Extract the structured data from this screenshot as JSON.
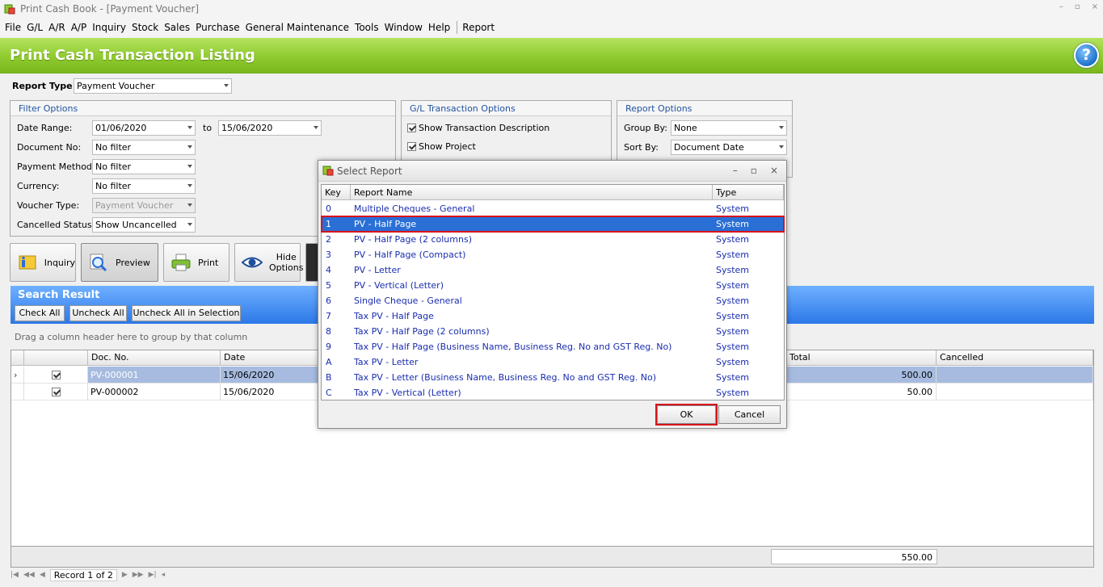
{
  "window": {
    "title": "Print Cash Book - [Payment Voucher]",
    "controls": [
      "–",
      "▫",
      "×"
    ]
  },
  "menu": [
    "File",
    "G/L",
    "A/R",
    "A/P",
    "Inquiry",
    "Stock",
    "Sales",
    "Purchase",
    "General Maintenance",
    "Tools",
    "Window",
    "Help",
    "Report"
  ],
  "header": {
    "title": "Print Cash Transaction Listing",
    "help": "?"
  },
  "report_type": {
    "label": "Report Type",
    "value": "Payment Voucher"
  },
  "filter_options": {
    "title": "Filter Options",
    "date_range_label": "Date Range:",
    "date_from": "01/06/2020",
    "to_label": "to",
    "date_to": "15/06/2020",
    "document_no_label": "Document No:",
    "document_no": "No filter",
    "payment_method_label": "Payment Method:",
    "payment_method": "No filter",
    "currency_label": "Currency:",
    "currency": "No filter",
    "voucher_type_label": "Voucher Type:",
    "voucher_type": "Payment Voucher",
    "cancelled_status_label": "Cancelled Status:",
    "cancelled_status": "Show Uncancelled"
  },
  "gl_options": {
    "title": "G/L Transaction Options",
    "show_description": "Show Transaction Description",
    "show_project": "Show Project"
  },
  "report_options": {
    "title": "Report Options",
    "group_by_label": "Group By:",
    "group_by": "None",
    "sort_by_label": "Sort By:",
    "sort_by": "Document Date"
  },
  "actions": {
    "inquiry": "Inquiry",
    "preview": "Preview",
    "print": "Print",
    "hide_line1": "Hide",
    "hide_line2": "Options"
  },
  "search_result": {
    "title": "Search Result",
    "check_all": "Check All",
    "uncheck_all": "Uncheck All",
    "uncheck_selection": "Uncheck All in Selection",
    "group_hint": "Drag a column header here to group by that column",
    "columns": {
      "doc_no": "Doc. No.",
      "date": "Date",
      "total": "Total",
      "cancelled": "Cancelled"
    },
    "rows": [
      {
        "doc_no": "PV-000001",
        "date": "15/06/2020",
        "total": "500.00",
        "cancelled": ""
      },
      {
        "doc_no": "PV-000002",
        "date": "15/06/2020",
        "total": "50.00",
        "cancelled": ""
      }
    ],
    "grand_total": "550.00",
    "record_text": "Record 1 of 2"
  },
  "dialog": {
    "title": "Select Report",
    "columns": {
      "key": "Key",
      "name": "Report Name",
      "type": "Type"
    },
    "rows": [
      {
        "key": "0",
        "name": "Multiple Cheques - General",
        "type": "System"
      },
      {
        "key": "1",
        "name": "PV - Half Page",
        "type": "System"
      },
      {
        "key": "2",
        "name": "PV - Half Page (2 columns)",
        "type": "System"
      },
      {
        "key": "3",
        "name": "PV - Half Page (Compact)",
        "type": "System"
      },
      {
        "key": "4",
        "name": "PV - Letter",
        "type": "System"
      },
      {
        "key": "5",
        "name": "PV - Vertical (Letter)",
        "type": "System"
      },
      {
        "key": "6",
        "name": "Single Cheque - General",
        "type": "System"
      },
      {
        "key": "7",
        "name": "Tax PV - Half Page",
        "type": "System"
      },
      {
        "key": "8",
        "name": "Tax PV - Half Page (2 columns)",
        "type": "System"
      },
      {
        "key": "9",
        "name": "Tax PV - Half Page (Business Name, Business Reg. No and GST Reg. No)",
        "type": "System"
      },
      {
        "key": "A",
        "name": "Tax PV - Letter",
        "type": "System"
      },
      {
        "key": "B",
        "name": "Tax PV - Letter (Business Name, Business Reg. No and GST Reg. No)",
        "type": "System"
      },
      {
        "key": "C",
        "name": "Tax PV - Vertical (Letter)",
        "type": "System"
      }
    ],
    "ok": "OK",
    "cancel": "Cancel"
  },
  "colors": {
    "header_green": "#8fcb2f",
    "result_blue": "#2c78e8",
    "highlight_red": "#d8141a",
    "selection_blue": "#2a6fd6"
  }
}
